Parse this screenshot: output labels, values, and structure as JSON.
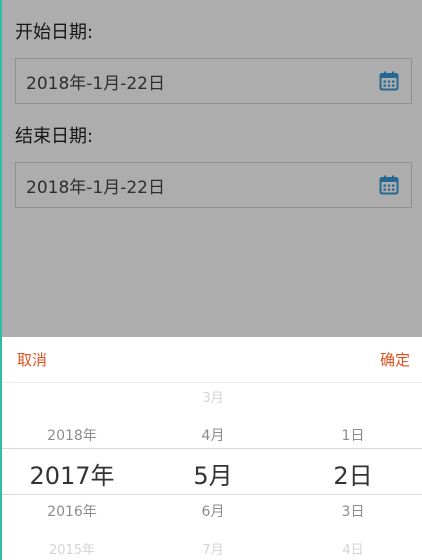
{
  "form": {
    "start_label": "开始日期:",
    "start_value": "2018年-1月-22日",
    "end_label": "结束日期:",
    "end_value": "2018年-1月-22日"
  },
  "picker": {
    "cancel_label": "取消",
    "confirm_label": "确定",
    "year": {
      "above_far": "",
      "above": "2018年",
      "selected": "2017年",
      "below": "2016年",
      "below_far": "2015年"
    },
    "month": {
      "above_far": "3月",
      "above": "4月",
      "selected": "5月",
      "below": "6月",
      "below_far": "7月"
    },
    "day": {
      "above_far": "",
      "above": "1日",
      "selected": "2日",
      "below": "3日",
      "below_far": "4日"
    }
  },
  "colors": {
    "accent": "#e0501f",
    "calendar_icon": "#3a9ad9",
    "overlay": "rgba(0,0,0,0.32)",
    "left_edge": "#2bbfa4"
  },
  "icons": {
    "start_calendar": "calendar-icon",
    "end_calendar": "calendar-icon"
  }
}
